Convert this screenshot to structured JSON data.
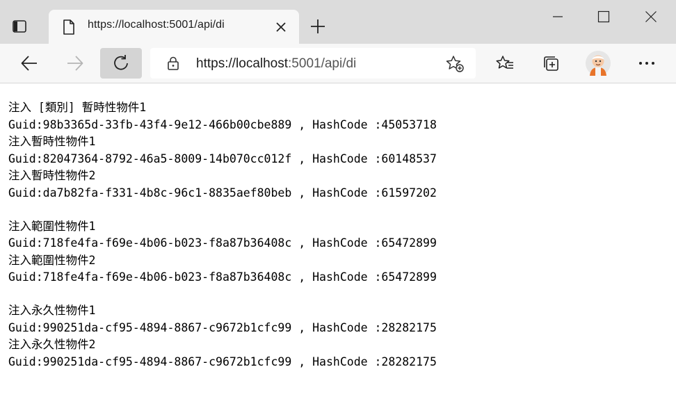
{
  "browser": {
    "tab": {
      "title": "https://localhost:5001/api/di"
    },
    "address": {
      "url_host": "https://localhost",
      "url_rest": ":5001/api/di"
    }
  },
  "page": {
    "groups": [
      [
        "注入 [類別] 暫時性物件1",
        "Guid:98b3365d-33fb-43f4-9e12-466b00cbe889 , HashCode :45053718",
        "注入暫時性物件1",
        "Guid:82047364-8792-46a5-8009-14b070cc012f , HashCode :60148537",
        "注入暫時性物件2",
        "Guid:da7b82fa-f331-4b8c-96c1-8835aef80beb , HashCode :61597202"
      ],
      [
        "注入範圍性物件1",
        "Guid:718fe4fa-f69e-4b06-b023-f8a87b36408c , HashCode :65472899",
        "注入範圍性物件2",
        "Guid:718fe4fa-f69e-4b06-b023-f8a87b36408c , HashCode :65472899"
      ],
      [
        "注入永久性物件1",
        "Guid:990251da-cf95-4894-8867-c9672b1cfc99 , HashCode :28282175",
        "注入永久性物件2",
        "Guid:990251da-cf95-4894-8867-c9672b1cfc99 , HashCode :28282175"
      ]
    ]
  }
}
